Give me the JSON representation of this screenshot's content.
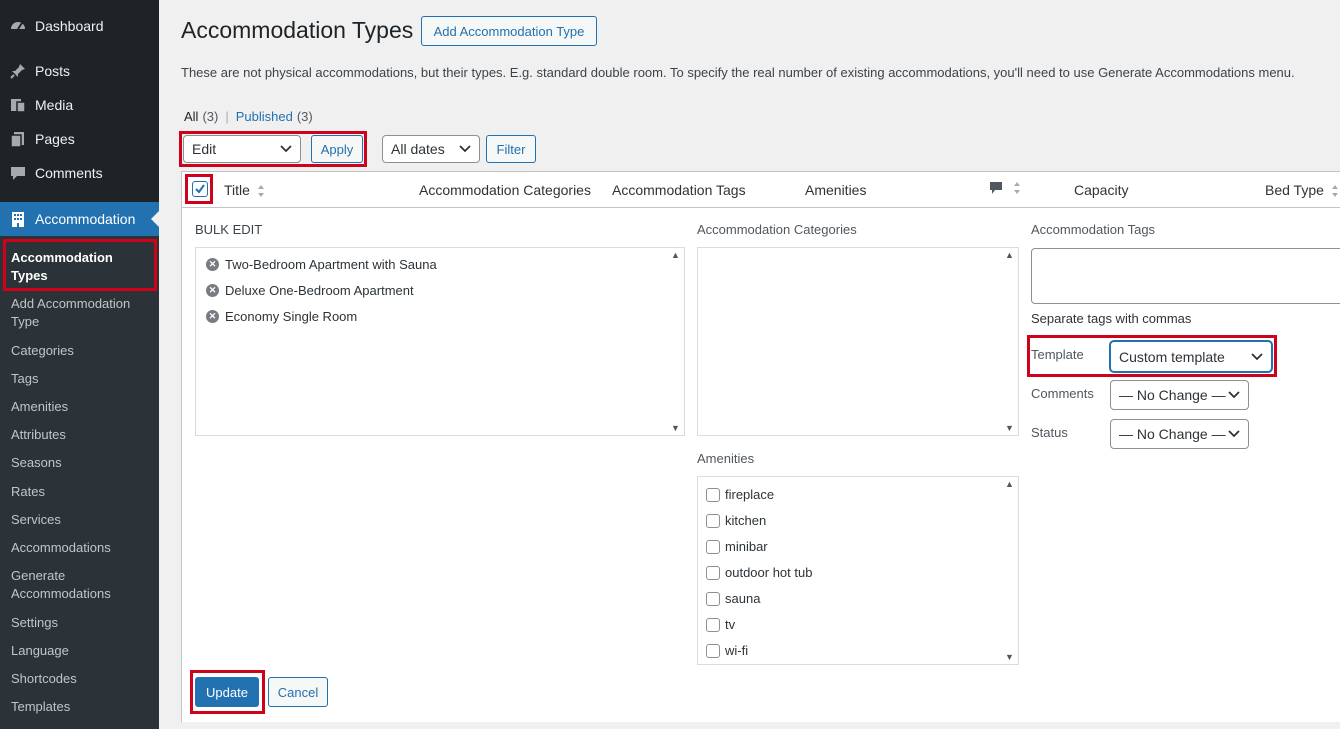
{
  "sidebar": {
    "menu": [
      {
        "label": "Dashboard",
        "icon": "dashboard-icon"
      },
      {
        "label": "Posts",
        "icon": "pin-icon"
      },
      {
        "label": "Media",
        "icon": "media-icon"
      },
      {
        "label": "Pages",
        "icon": "pages-icon"
      },
      {
        "label": "Comments",
        "icon": "comment-icon"
      },
      {
        "label": "Accommodation",
        "icon": "building-icon"
      }
    ],
    "submenu": [
      "Accommodation Types",
      "Add Accommodation Type",
      "Categories",
      "Tags",
      "Amenities",
      "Attributes",
      "Seasons",
      "Rates",
      "Services",
      "Accommodations",
      "Generate Accommodations",
      "Settings",
      "Language",
      "Shortcodes",
      "Templates"
    ]
  },
  "header": {
    "title": "Accommodation Types",
    "add_button": "Add Accommodation Type",
    "description": "These are not physical accommodations, but their types. E.g. standard double room. To specify the real number of existing accommodations, you'll need to use Generate Accommodations menu."
  },
  "filters": {
    "all_label": "All",
    "all_count": "(3)",
    "separator": "|",
    "published_label": "Published",
    "published_count": "(3)",
    "bulk_action": "Edit",
    "apply": "Apply",
    "dates": "All dates",
    "filter": "Filter"
  },
  "table": {
    "columns": {
      "title": "Title",
      "categories": "Accommodation Categories",
      "tags": "Accommodation Tags",
      "amenities": "Amenities",
      "capacity": "Capacity",
      "bed_type": "Bed Type"
    }
  },
  "bulk_edit": {
    "heading": "BULK EDIT",
    "items": [
      "Two-Bedroom Apartment with Sauna",
      "Deluxe One-Bedroom Apartment",
      "Economy Single Room"
    ],
    "categories_label": "Accommodation Categories",
    "amenities_label": "Amenities",
    "amenities": [
      "fireplace",
      "kitchen",
      "minibar",
      "outdoor hot tub",
      "sauna",
      "tv",
      "wi-fi"
    ],
    "tags_label": "Accommodation Tags",
    "tags_hint": "Separate tags with commas",
    "template_label": "Template",
    "template_value": "Custom template",
    "comments_label": "Comments",
    "comments_value": "— No Change —",
    "status_label": "Status",
    "status_value": "— No Change —",
    "update": "Update",
    "cancel": "Cancel"
  },
  "colors": {
    "accent": "#2271b1",
    "highlight": "#d0021b",
    "sidebar_bg": "#1d2327"
  }
}
